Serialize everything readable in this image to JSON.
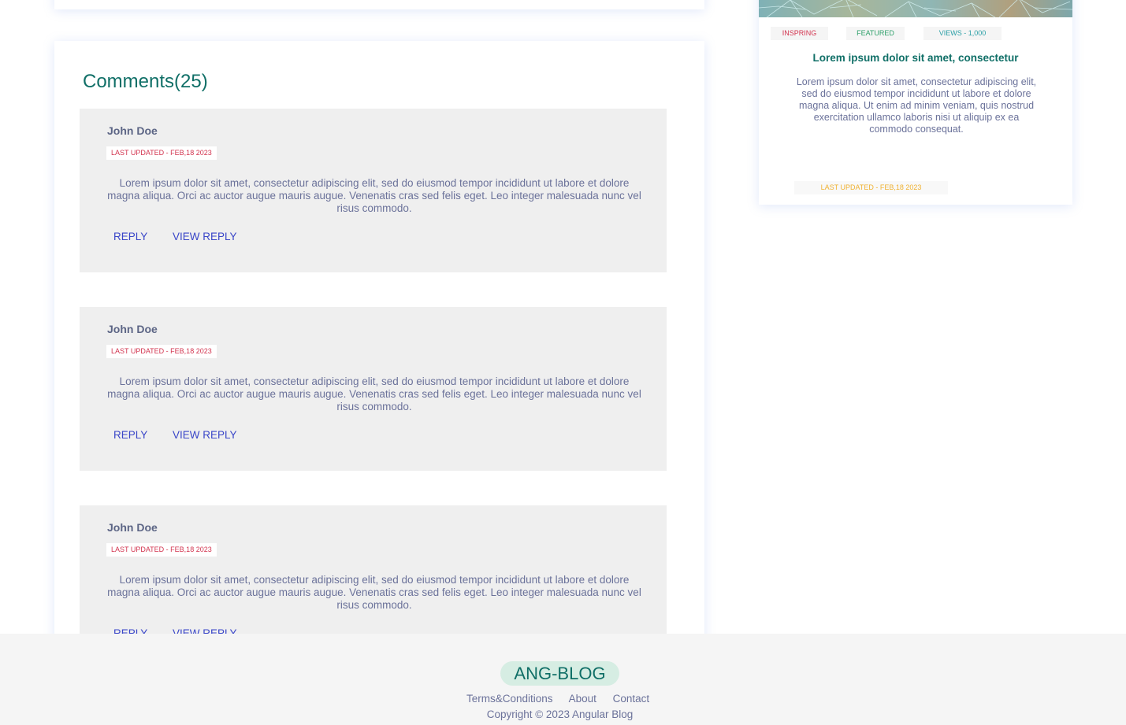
{
  "comments_section": {
    "title": "Comments(25)",
    "items": [
      {
        "author": "John Doe",
        "date": "LAST UPDATED - FEB,18 2023",
        "text": "Lorem ipsum dolor sit amet, consectetur adipiscing elit, sed do eiusmod tempor incididunt ut labore et dolore magna aliqua. Orci ac auctor augue mauris augue. Venenatis cras sed felis eget. Leo integer malesuada nunc vel risus commodo.",
        "reply_label": "REPLY",
        "view_reply_label": "VIEW REPLY"
      },
      {
        "author": "John Doe",
        "date": "LAST UPDATED - FEB,18 2023",
        "text": "Lorem ipsum dolor sit amet, consectetur adipiscing elit, sed do eiusmod tempor incididunt ut labore et dolore magna aliqua. Orci ac auctor augue mauris augue. Venenatis cras sed felis eget. Leo integer malesuada nunc vel risus commodo.",
        "reply_label": "REPLY",
        "view_reply_label": "VIEW REPLY"
      },
      {
        "author": "John Doe",
        "date": "LAST UPDATED - FEB,18 2023",
        "text": "Lorem ipsum dolor sit amet, consectetur adipiscing elit, sed do eiusmod tempor incididunt ut labore et dolore magna aliqua. Orci ac auctor augue mauris augue. Venenatis cras sed felis eget. Leo integer malesuada nunc vel risus commodo.",
        "reply_label": "REPLY",
        "view_reply_label": "VIEW REPLY"
      }
    ]
  },
  "side_post": {
    "tags": [
      "INSPRING",
      "FEATURED",
      "VIEWS - 1,000"
    ],
    "title": "Lorem ipsum dolor sit amet, consectetur",
    "text": "Lorem ipsum dolor sit amet, consectetur adipiscing elit, sed do eiusmod tempor incididunt ut labore et dolore magna aliqua. Ut enim ad minim veniam, quis nostrud exercitation ullamco laboris nisi ut aliquip ex ea commodo consequat.",
    "date": "LAST UPDATED - FEB,18 2023"
  },
  "footer": {
    "logo": "ANG-BLOG",
    "links": [
      "Terms&Conditions",
      "About",
      "Contact"
    ],
    "copyright": "Copyright © 2023 Angular Blog"
  },
  "colors": {
    "accent": "#106f67",
    "link": "#3a46c8",
    "date_red": "#d2334e",
    "date_yellow": "#f0b232",
    "featured_green": "#2ea06a",
    "views_teal": "#2a9fa6",
    "body_text": "#6b729a"
  }
}
